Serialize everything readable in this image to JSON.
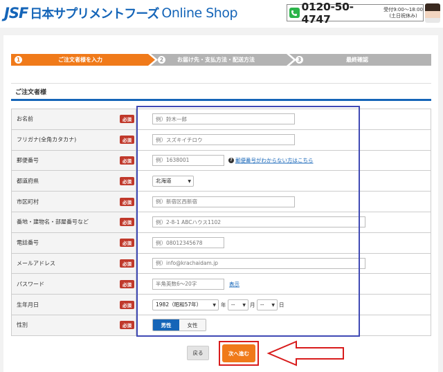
{
  "header": {
    "logo_mark": "JSF",
    "logo_name": "日本サプリメントフーズ",
    "logo_shop": "Online Shop",
    "phone": "0120-50-4747",
    "hours_line1": "受付9:00～18:00",
    "hours_line2": "(土日祝休み)"
  },
  "steps": [
    {
      "num": "1",
      "label": "ご注文者様を入力",
      "active": true
    },
    {
      "num": "2",
      "label": "お届け先・支払方法・配送方法",
      "active": false
    },
    {
      "num": "3",
      "label": "最終確認",
      "active": false
    }
  ],
  "colors": {
    "step_active": "#f07a1a",
    "step_inactive": "#b3b3b3",
    "brand_blue": "#1565b8",
    "required_red": "#c0392b",
    "annotation_blue": "#3f49b4",
    "annotation_red": "#d81b1b"
  },
  "section": {
    "title": "ご注文者様"
  },
  "form": {
    "required_badge": "必須",
    "name": {
      "label": "お名前",
      "placeholder": "例）鈴木一郎"
    },
    "kana": {
      "label": "フリガナ(全角カタカナ)",
      "placeholder": "例）スズキイチロウ"
    },
    "zip": {
      "label": "郵便番号",
      "placeholder": "例）1638001",
      "help_link": "郵便番号がわからない方はこちら"
    },
    "prefecture": {
      "label": "都道府県",
      "value": "北海道"
    },
    "city": {
      "label": "市区町村",
      "placeholder": "例）新宿区西新宿"
    },
    "address": {
      "label": "番地・建物名・部屋番号など",
      "placeholder": "例）2-8-1 ABCハウス1102"
    },
    "tel": {
      "label": "電話番号",
      "placeholder": "例）08012345678"
    },
    "email": {
      "label": "メールアドレス",
      "placeholder": "例）info@krachaidam.jp"
    },
    "password": {
      "label": "パスワード",
      "placeholder": "半角英数6～20字",
      "show_link": "表示"
    },
    "birthday": {
      "label": "生年月日",
      "year": "1982（昭和57年）",
      "year_unit": "年",
      "month": "--",
      "month_unit": "月",
      "day": "--",
      "day_unit": "日"
    },
    "gender": {
      "label": "性別",
      "option_male": "男性",
      "option_female": "女性",
      "selected": "男性"
    }
  },
  "buttons": {
    "back": "戻る",
    "next": "次へ進む"
  }
}
